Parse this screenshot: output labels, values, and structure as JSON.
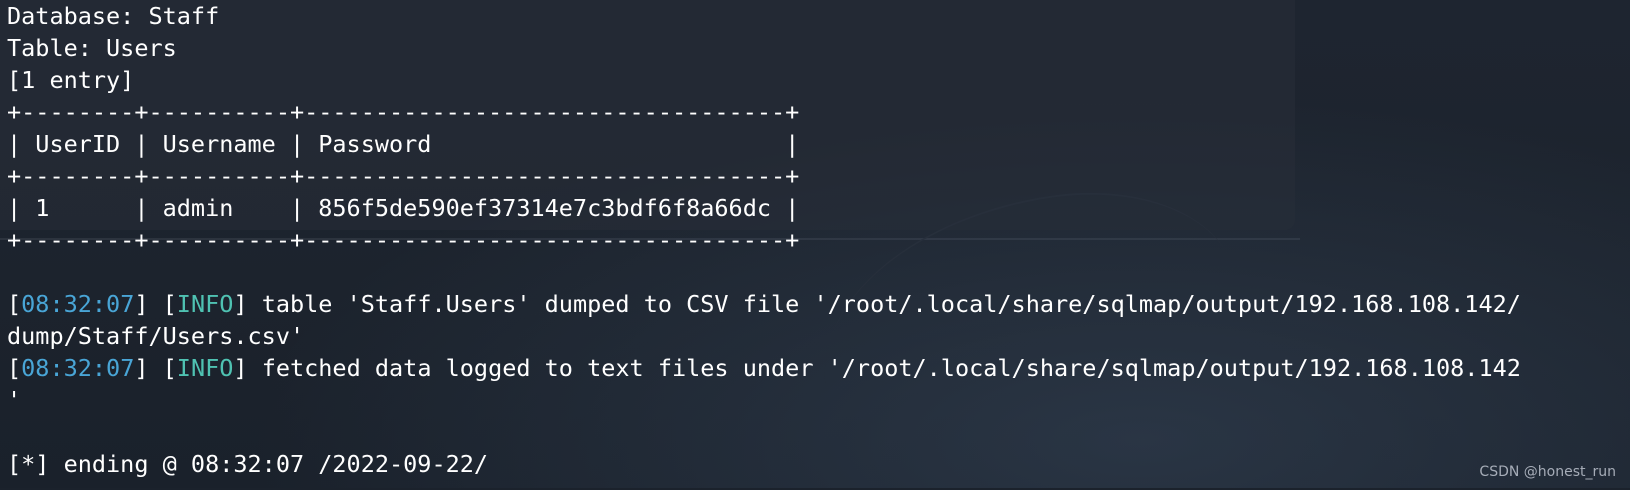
{
  "header": {
    "database_line": "Database: Staff",
    "table_line": "Table: Users",
    "entry_line": "[1 entry]"
  },
  "table": {
    "border_line": "+--------+----------+----------------------------------+",
    "header_row": "| UserID | Username | Password                         |",
    "data_row": "| 1      | admin    | 856f5de590ef37314e7c3bdf6f8a66dc |"
  },
  "log": [
    {
      "time": "08:32:07",
      "level": "INFO",
      "message": " table 'Staff.Users' dumped to CSV file '/root/.local/share/sqlmap/output/192.168.108.142/",
      "continuation": "dump/Staff/Users.csv'"
    },
    {
      "time": "08:32:07",
      "level": "INFO",
      "message": " fetched data logged to text files under '/root/.local/share/sqlmap/output/192.168.108.142",
      "continuation": "'"
    }
  ],
  "footer": {
    "ending_line": "[*] ending @ 08:32:07 /2022-09-22/"
  },
  "watermark": "CSDN @honest_run",
  "colors": {
    "background": "#1b222c",
    "text": "#ffffff",
    "timestamp": "#49a5d6",
    "info": "#4fc2b2"
  }
}
